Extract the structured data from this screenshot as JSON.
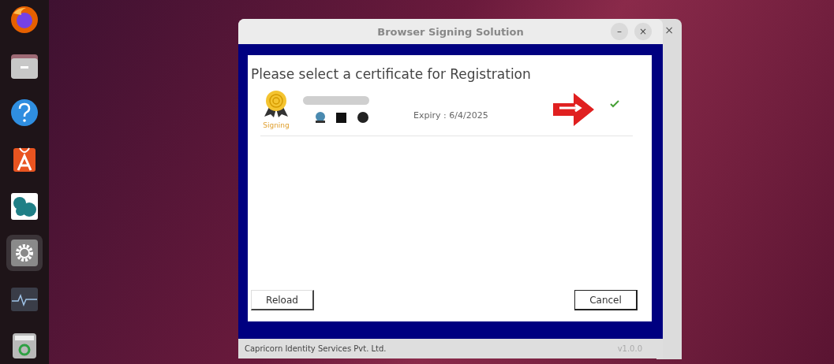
{
  "dock": {
    "items": [
      {
        "kind": "browser",
        "selected": false
      },
      {
        "kind": "folder",
        "selected": false
      },
      {
        "kind": "help",
        "selected": false
      },
      {
        "kind": "store",
        "selected": false
      },
      {
        "kind": "app",
        "selected": false
      },
      {
        "kind": "settings",
        "selected": true
      },
      {
        "kind": "monitor",
        "selected": false
      },
      {
        "kind": "trash",
        "selected": false
      }
    ]
  },
  "back_window": {
    "close": "×"
  },
  "window": {
    "title": "Browser Signing Solution",
    "minimize": "–",
    "close": "×",
    "heading": "Please select a certificate for Registration",
    "certificates": [
      {
        "usage": "Signing",
        "expiry": "Expiry : 6/4/2025",
        "selected": true
      }
    ],
    "buttons": [
      "Reload",
      "Cancel"
    ],
    "footer": {
      "company": "Capricorn Identity Services Pvt. Ltd.",
      "version": "v1.0.0"
    }
  }
}
